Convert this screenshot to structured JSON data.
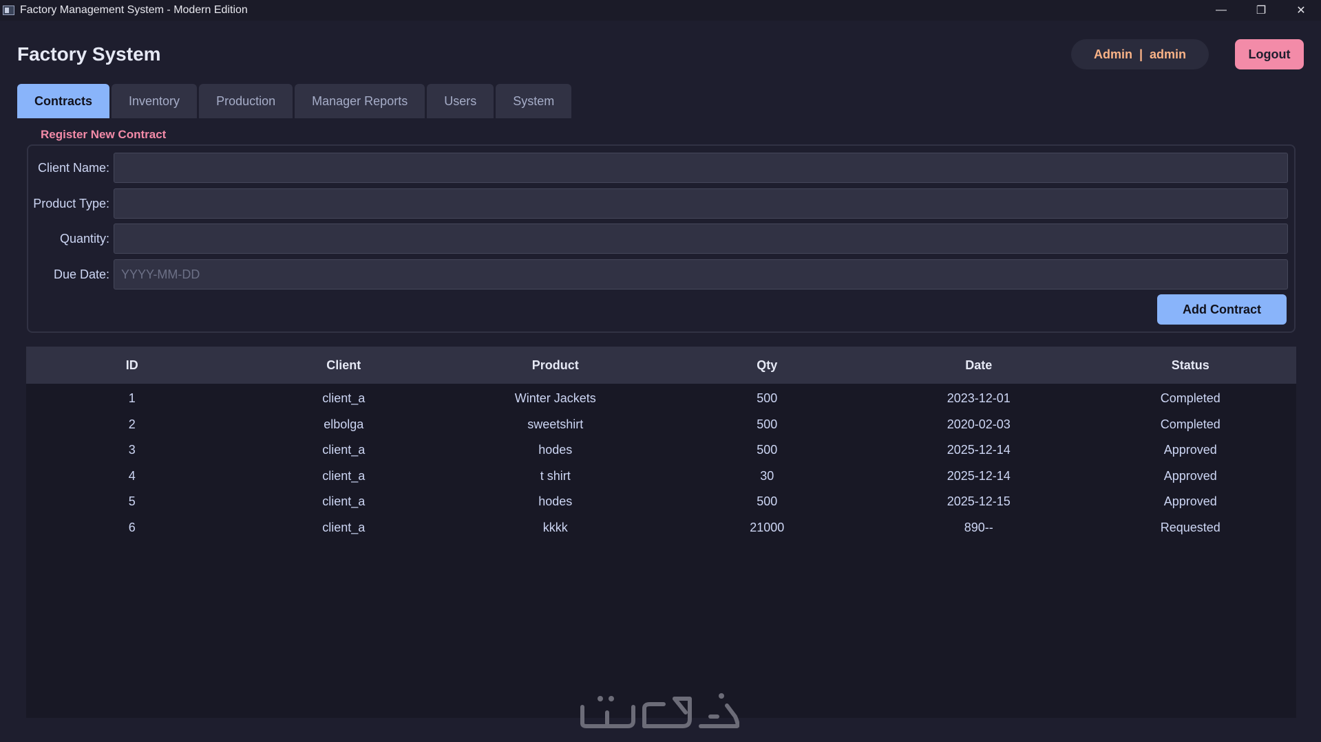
{
  "window": {
    "title": "Factory Management System - Modern Edition",
    "controls": {
      "minimize": "—",
      "restore": "❐",
      "close": "✕"
    }
  },
  "header": {
    "brand": "Factory System",
    "user_role": "Admin",
    "separator": "|",
    "username": "admin",
    "logout_label": "Logout"
  },
  "tabs": [
    {
      "label": "Contracts",
      "active": true
    },
    {
      "label": "Inventory",
      "active": false
    },
    {
      "label": "Production",
      "active": false
    },
    {
      "label": "Manager Reports",
      "active": false
    },
    {
      "label": "Users",
      "active": false
    },
    {
      "label": "System",
      "active": false
    }
  ],
  "form": {
    "section_title": "Register New Contract",
    "client_name": {
      "label": "Client Name:",
      "value": ""
    },
    "product_type": {
      "label": "Product Type:",
      "value": ""
    },
    "quantity": {
      "label": "Quantity:",
      "value": ""
    },
    "due_date": {
      "label": "Due Date:",
      "value": "",
      "placeholder": "YYYY-MM-DD"
    },
    "submit_label": "Add Contract"
  },
  "table": {
    "columns": [
      "ID",
      "Client",
      "Product",
      "Qty",
      "Date",
      "Status"
    ],
    "rows": [
      [
        "1",
        "client_a",
        "Winter Jackets",
        "500",
        "2023-12-01",
        "Completed"
      ],
      [
        "2",
        "elbolga",
        "sweetshirt",
        "500",
        "2020-02-03",
        "Completed"
      ],
      [
        "3",
        "client_a",
        "hodes",
        "500",
        "2025-12-14",
        "Approved"
      ],
      [
        "4",
        "client_a",
        "t shirt",
        "30",
        "2025-12-14",
        "Approved"
      ],
      [
        "5",
        "client_a",
        "hodes",
        "500",
        "2025-12-15",
        "Approved"
      ],
      [
        "6",
        "client_a",
        "kkkk",
        "21000",
        "890--",
        "Requested"
      ]
    ]
  },
  "colors": {
    "background": "#1e1e2e",
    "accent": "#89b4fa",
    "danger": "#f38ba8",
    "user_text": "#fab387"
  },
  "watermark": {
    "text": "خمسات"
  }
}
